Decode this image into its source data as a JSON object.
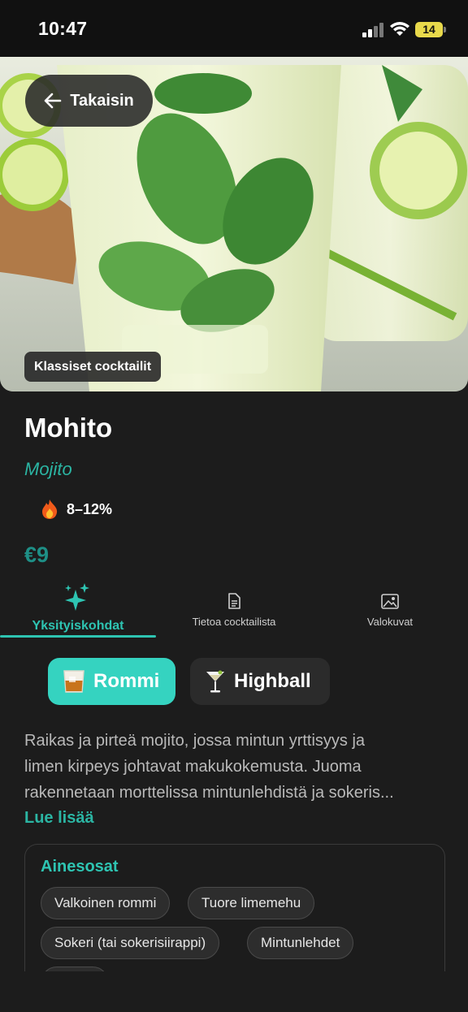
{
  "status": {
    "time": "10:47",
    "battery": "14"
  },
  "hero": {
    "back_label": "Takaisin",
    "category_badge": "Klassiset cocktailit"
  },
  "drink": {
    "name": "Mohito",
    "alt_name": "Mojito",
    "abv": "8–12%",
    "price": "€9"
  },
  "tabs": [
    {
      "label": "Yksityiskohdat",
      "icon": "sparkles-icon",
      "active": true
    },
    {
      "label": "Tietoa cocktailista",
      "icon": "document-icon",
      "active": false
    },
    {
      "label": "Valokuvat",
      "icon": "photos-icon",
      "active": false
    }
  ],
  "chips": [
    {
      "label": "Rommi",
      "icon": "tumbler-glass-icon"
    },
    {
      "label": "Highball",
      "icon": "cocktail-glass-icon"
    }
  ],
  "description": {
    "lines": [
      "Raikas ja pirteä mojito, jossa mintun yrttisyys ja",
      "limen kirpeys johtavat makukokemusta. Juoma",
      "rakennetaan morttelissa mintunlehdistä ja sokeris..."
    ],
    "read_more": "Lue lisää"
  },
  "ingredients": {
    "title": "Ainesosat",
    "items": [
      "Valkoinen rommi",
      "Tuore limemehu",
      "Sokeri (tai sokerisiirappi)",
      "Mintunlehdet"
    ]
  },
  "colors": {
    "accent": "#2ec4b2",
    "chip_primary": "#35d3c0",
    "background": "#1c1c1c"
  }
}
